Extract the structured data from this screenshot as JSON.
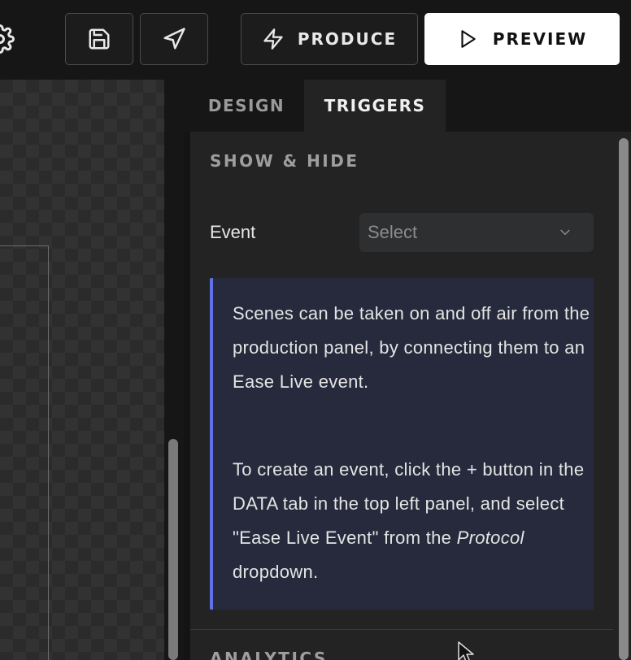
{
  "toolbar": {
    "settings_icon": "gear-icon",
    "save_icon": "floppy-disk-icon",
    "send_icon": "paper-plane-icon",
    "produce_icon": "lightning-icon",
    "produce_label": "PRODUCE",
    "preview_icon": "play-icon",
    "preview_label": "PREVIEW"
  },
  "tabs": [
    {
      "label": "DESIGN",
      "active": false
    },
    {
      "label": "TRIGGERS",
      "active": true
    }
  ],
  "show_hide": {
    "title": "SHOW & HIDE",
    "event_label": "Event",
    "event_select": {
      "value": "Select",
      "icon": "chevron-down-icon"
    }
  },
  "info": {
    "paragraph1": "Scenes can be taken on and off air from the production panel, by connecting them to an Ease Live event.",
    "paragraph2_before": "To create an event, click the + button in the DATA tab in the top left panel, and select \"Ease Live Event\" from the ",
    "paragraph2_italic": "Protocol",
    "paragraph2_after": " dropdown."
  },
  "next_section": {
    "title": "ANALYTICS"
  },
  "colors": {
    "accent_border": "#5f72e6",
    "info_bg": "#262a3c",
    "panel_bg": "#232323",
    "preview_bg": "#ffffff"
  }
}
